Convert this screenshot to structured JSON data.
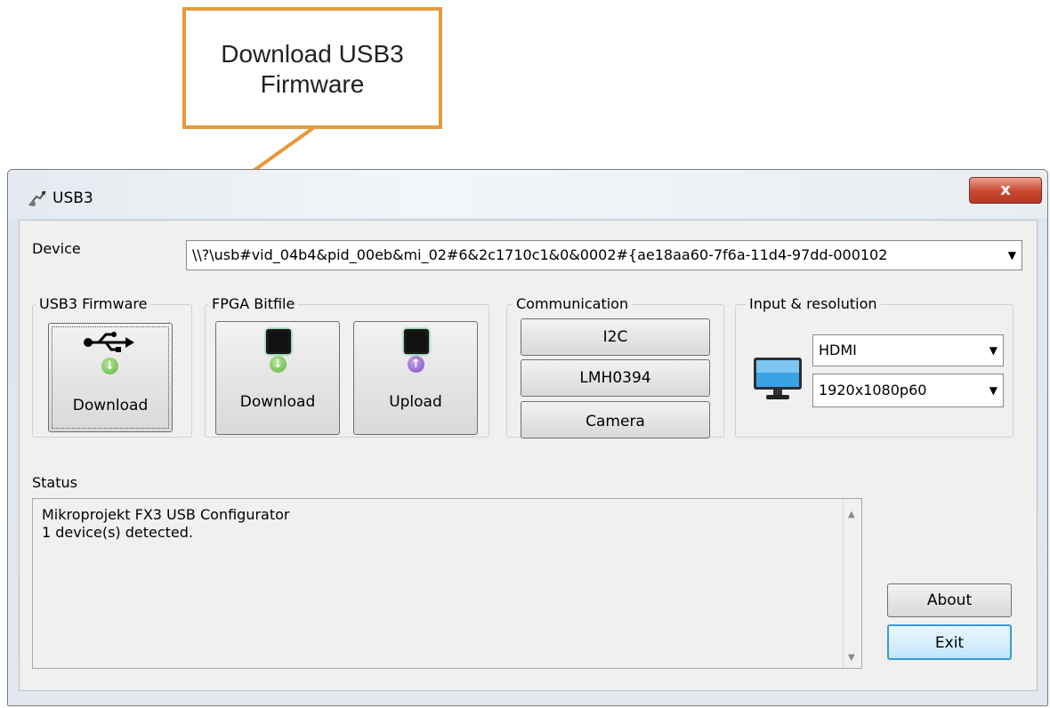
{
  "callout": {
    "line1": "Download USB3",
    "line2": "Firmware"
  },
  "window": {
    "title": "USB3",
    "close_symbol": "x"
  },
  "device": {
    "label": "Device",
    "value": "\\\\?\\usb#vid_04b4&pid_00eb&mi_02#6&2c1710c1&0&0002#{ae18aa60-7f6a-11d4-97dd-000102"
  },
  "usb3_firmware": {
    "label": "USB3 Firmware",
    "download_label": "Download",
    "icon": "usb-icon"
  },
  "fpga_bitfile": {
    "label": "FPGA Bitfile",
    "download_label": "Download",
    "upload_label": "Upload",
    "icon": "chip-icon"
  },
  "communication": {
    "label": "Communication",
    "buttons": [
      "I2C",
      "LMH0394",
      "Camera"
    ]
  },
  "input_resolution": {
    "label": "Input & resolution",
    "input": "HDMI",
    "resolution": "1920x1080p60",
    "icon": "monitor-icon"
  },
  "status": {
    "label": "Status",
    "lines": [
      "Mikroprojekt FX3 USB Configurator",
      "1 device(s) detected."
    ]
  },
  "buttons": {
    "about": "About",
    "exit": "Exit"
  },
  "colors": {
    "callout_border": "#e69a3a",
    "close_button": "#c9472f",
    "exit_focus": "#3c9ad6"
  }
}
